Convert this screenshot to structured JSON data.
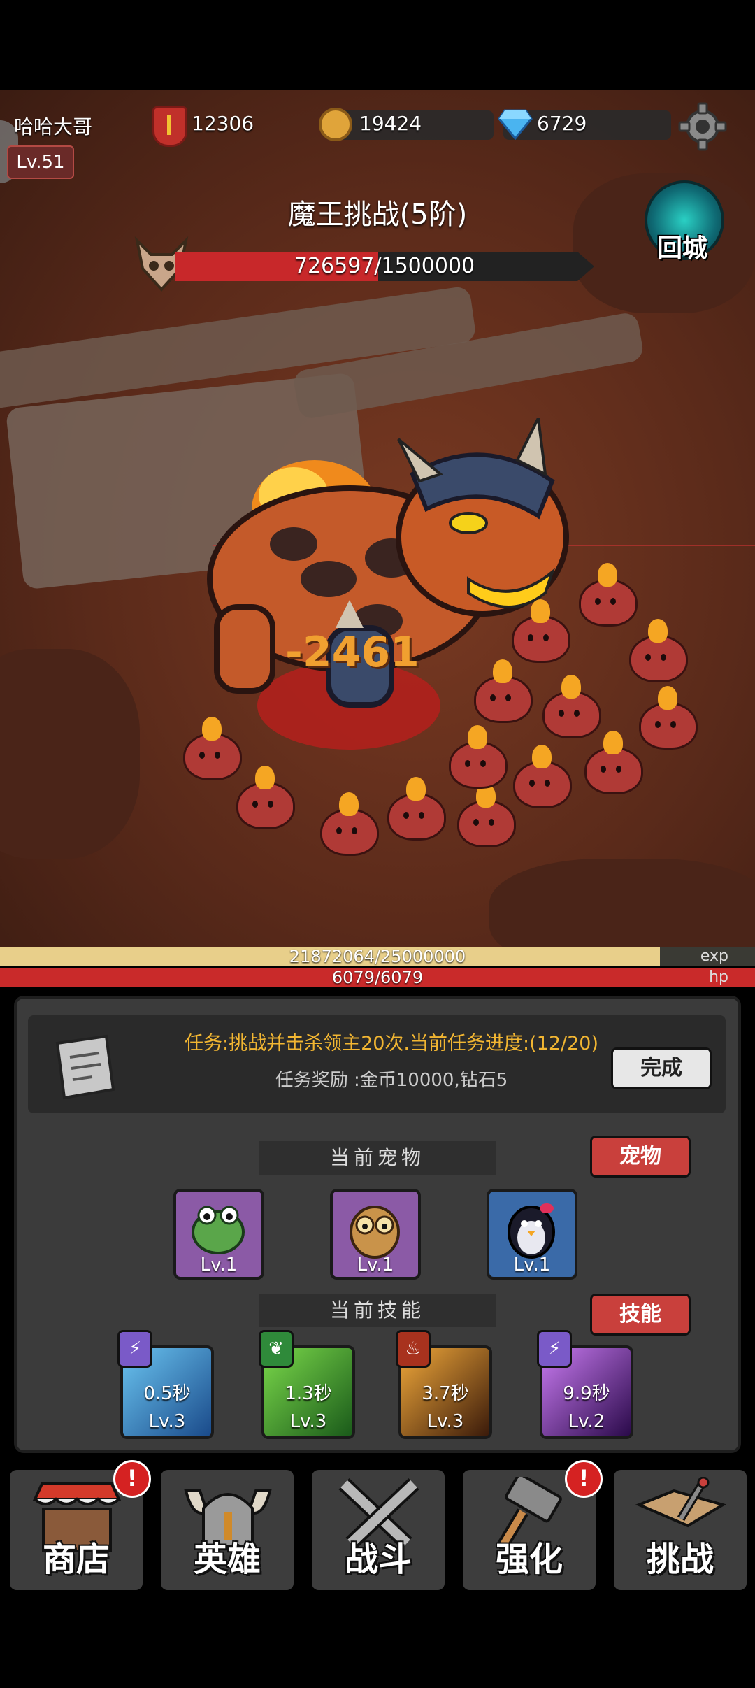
{
  "player": {
    "name": "哈哈大哥",
    "level": "Lv.51"
  },
  "resources": {
    "power": "12306",
    "gold": "19424",
    "diamonds": "6729"
  },
  "boss": {
    "title": "魔王挑战(5阶)",
    "hp_text": "726597/1500000",
    "hp_current": 726597,
    "hp_max": 1500000
  },
  "return_button": {
    "label": "回城"
  },
  "damage_popup": "-2461",
  "exp": {
    "text": "21872064/25000000",
    "current": 21872064,
    "max": 25000000,
    "tag": "exp"
  },
  "hp": {
    "text": "6079/6079",
    "tag": "hp"
  },
  "quest": {
    "text": "任务:挑战并击杀领主20次.当前任务进度:(12/20)",
    "reward": "任务奖励 :金币10000,钻石5",
    "complete_label": "完成"
  },
  "pets": {
    "section_label": "当前宠物",
    "button_label": "宠物",
    "items": [
      {
        "level": "Lv.1",
        "icon": "frog-pet-icon",
        "color": "#8b5aa6"
      },
      {
        "level": "Lv.1",
        "icon": "owl-pet-icon",
        "color": "#8b5aa6"
      },
      {
        "level": "Lv.1",
        "icon": "penguin-pet-icon",
        "color": "#3a6aa8"
      }
    ]
  },
  "skills": {
    "section_label": "当前技能",
    "button_label": "技能",
    "items": [
      {
        "time": "0.5秒",
        "level": "Lv.3",
        "element": "lightning",
        "color": "#2f7fc4"
      },
      {
        "time": "1.3秒",
        "level": "Lv.3",
        "element": "nature",
        "color": "#2f9a38"
      },
      {
        "time": "3.7秒",
        "level": "Lv.3",
        "element": "fire",
        "color": "#8a4a1c"
      },
      {
        "time": "9.9秒",
        "level": "Lv.2",
        "element": "lightning",
        "color": "#6a2fa8"
      }
    ]
  },
  "nav": {
    "items": [
      {
        "label": "商店",
        "icon": "shop-icon",
        "badge": true
      },
      {
        "label": "英雄",
        "icon": "helmet-icon",
        "badge": false
      },
      {
        "label": "战斗",
        "icon": "crossed-swords-icon",
        "badge": false
      },
      {
        "label": "强化",
        "icon": "hammer-icon",
        "badge": true
      },
      {
        "label": "挑战",
        "icon": "map-icon",
        "badge": false
      }
    ]
  }
}
